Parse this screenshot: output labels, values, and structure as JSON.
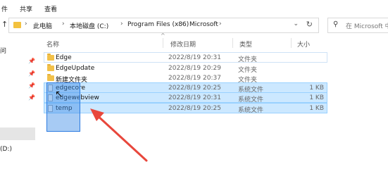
{
  "ribbon": {
    "tabs": [
      "件",
      "共享",
      "查看"
    ]
  },
  "address": {
    "crumbs": [
      "此电脑",
      "本地磁盘 (C:)",
      "Program Files (x86)",
      "Microsoft"
    ]
  },
  "search": {
    "placeholder": "在 Microsoft 中"
  },
  "sidebar": {
    "items": [
      "问",
      "(D:)"
    ]
  },
  "columns": {
    "name": "名称",
    "date": "修改日期",
    "type": "类型",
    "size": "大小"
  },
  "files": [
    {
      "name": "Edge",
      "date": "2022/8/19 20:31",
      "type": "文件夹",
      "size": ""
    },
    {
      "name": "EdgeUpdate",
      "date": "2022/8/19 20:29",
      "type": "文件夹",
      "size": ""
    },
    {
      "name": "新建文件夹",
      "date": "2022/8/19 20:37",
      "type": "文件夹",
      "size": ""
    },
    {
      "name": "edgecore",
      "date": "2022/8/19 20:25",
      "type": "系统文件",
      "size": "1 KB"
    },
    {
      "name": "edgewebview",
      "date": "2022/8/19 20:31",
      "type": "系统文件",
      "size": "1 KB"
    },
    {
      "name": "temp",
      "date": "2022/8/19 20:25",
      "type": "系统文件",
      "size": "1 KB"
    }
  ],
  "colors": {
    "selection": "#cce8ff",
    "accent": "#e8473c",
    "folder": "#f2c14a"
  }
}
